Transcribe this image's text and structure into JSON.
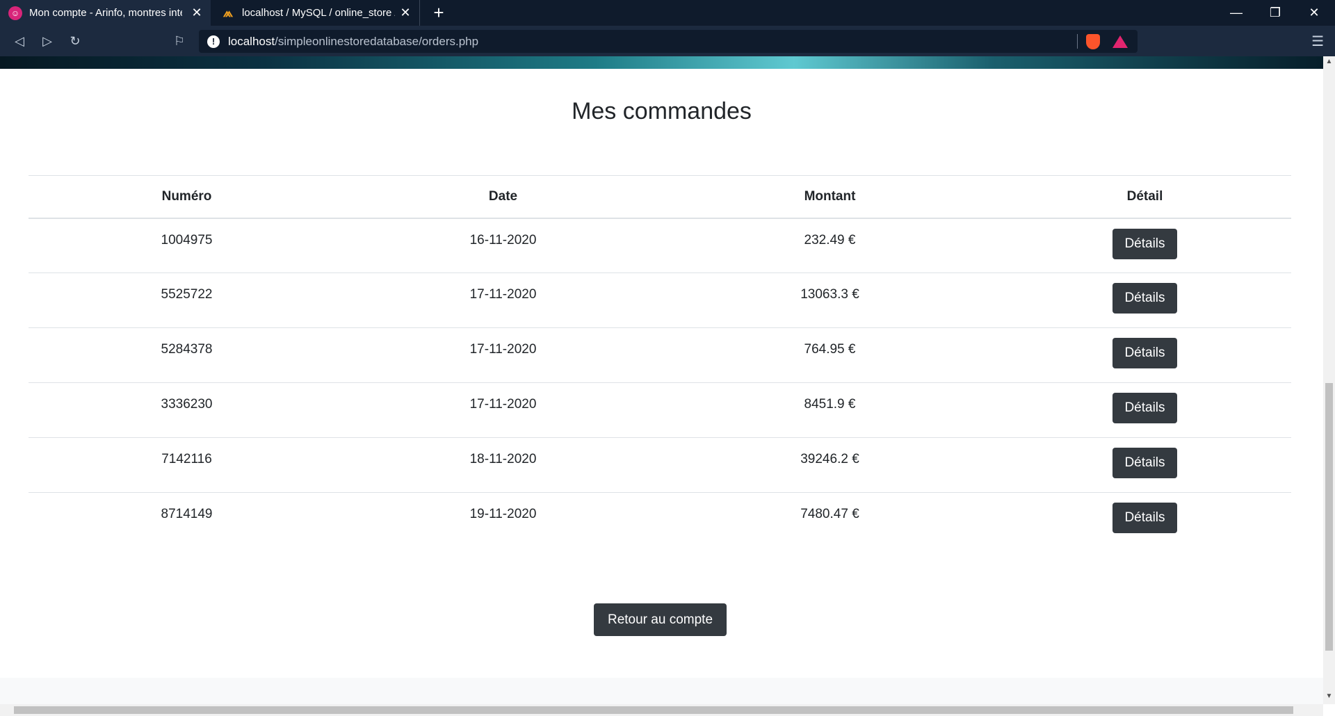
{
  "browser": {
    "tabs": [
      {
        "title": "Mon compte - Arinfo, montres inte",
        "active": true,
        "favicon": "site-logo-icon"
      },
      {
        "title": "localhost / MySQL / online_store /",
        "active": false,
        "favicon": "phpmyadmin-icon"
      }
    ],
    "url_host": "localhost",
    "url_path": "/simpleonlinestoredatabase/orders.php"
  },
  "page": {
    "title": "Mes commandes",
    "table": {
      "headers": [
        "Numéro",
        "Date",
        "Montant",
        "Détail"
      ],
      "rows": [
        {
          "numero": "1004975",
          "date": "16-11-2020",
          "montant": "232.49 €",
          "detail_label": "Détails"
        },
        {
          "numero": "5525722",
          "date": "17-11-2020",
          "montant": "13063.3 €",
          "detail_label": "Détails"
        },
        {
          "numero": "5284378",
          "date": "17-11-2020",
          "montant": "764.95 €",
          "detail_label": "Détails"
        },
        {
          "numero": "3336230",
          "date": "17-11-2020",
          "montant": "8451.9 €",
          "detail_label": "Détails"
        },
        {
          "numero": "7142116",
          "date": "18-11-2020",
          "montant": "39246.2 €",
          "detail_label": "Détails"
        },
        {
          "numero": "8714149",
          "date": "19-11-2020",
          "montant": "7480.47 €",
          "detail_label": "Détails"
        }
      ]
    },
    "back_button": "Retour au compte"
  },
  "colors": {
    "button_bg": "#343a40",
    "tabbar_bg": "#0f1b2c",
    "toolbar_bg": "#1c2a3f"
  }
}
